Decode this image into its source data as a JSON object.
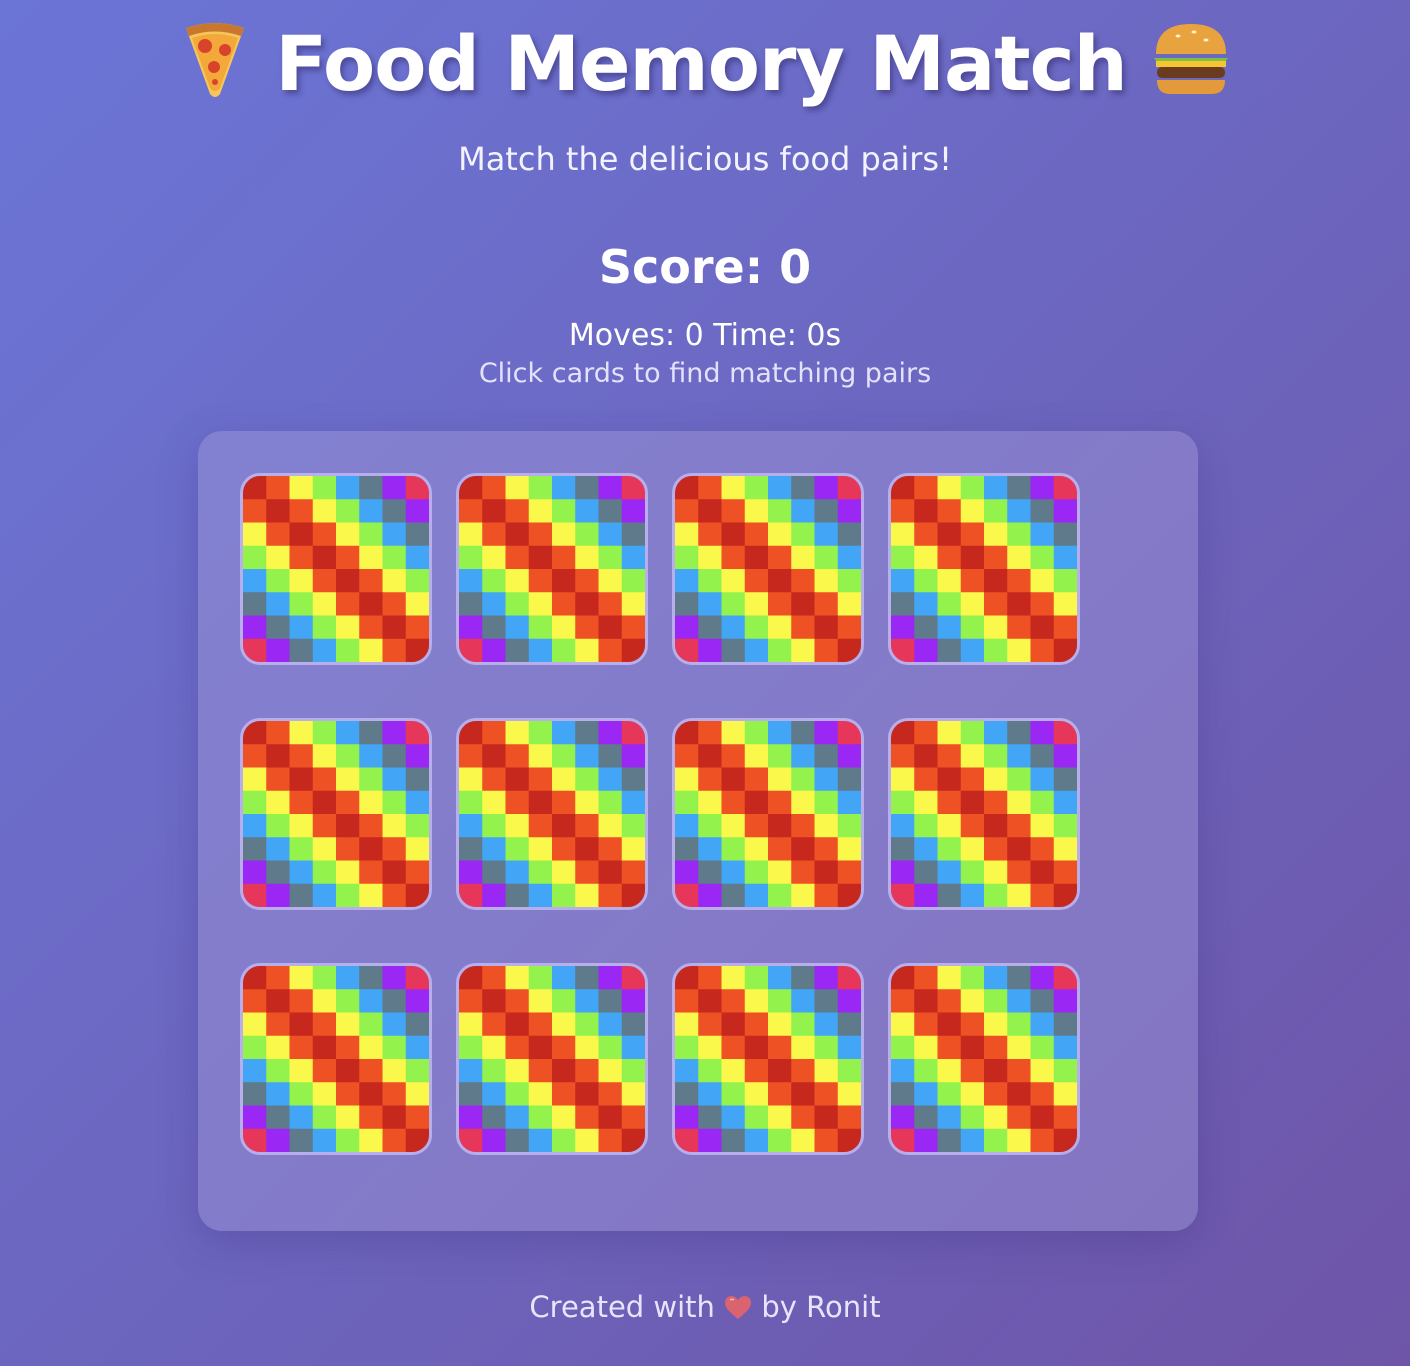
{
  "header": {
    "title": "Food Memory Match",
    "left_icon": "pizza-icon",
    "right_icon": "burger-icon",
    "subtitle": "Match the delicious food pairs!"
  },
  "stats": {
    "score_text": "Score: 0",
    "moves_label": "Moves:",
    "moves": "0",
    "time_label": "Time:",
    "time": "0s",
    "hint": "Click cards to find matching pairs"
  },
  "board": {
    "rows": 3,
    "cols": 4,
    "card_state": "face-down",
    "card_back_colors": [
      "#e6375a",
      "#9b27f5",
      "#5f7a8a",
      "#42a5f5",
      "#94f24c",
      "#faf84a",
      "#ee5124",
      "#c6281e"
    ]
  },
  "footer": {
    "prefix": "Created with",
    "icon": "heart-icon",
    "suffix": "by Ronit"
  }
}
